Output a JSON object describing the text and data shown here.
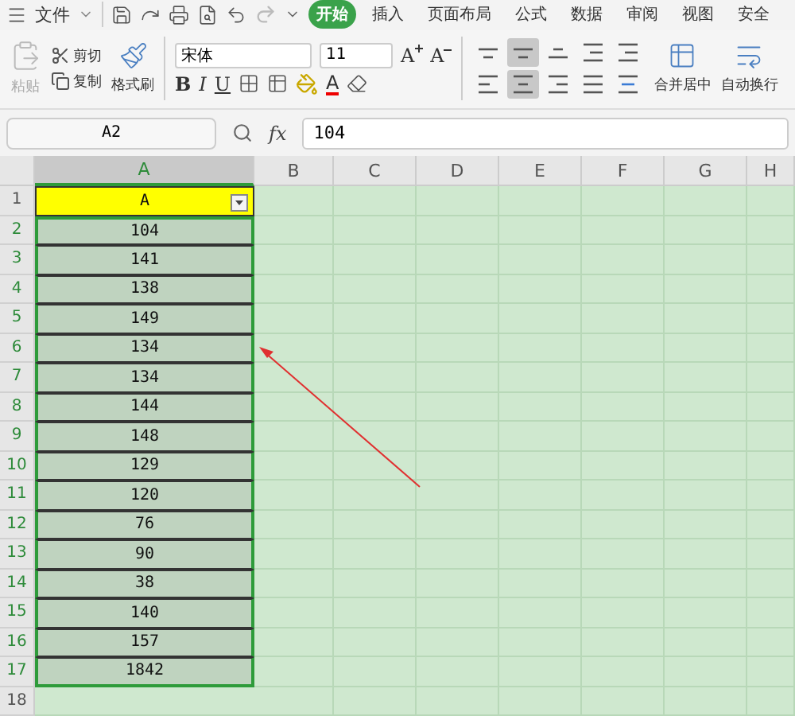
{
  "menu": {
    "file": "文件",
    "tabs": [
      {
        "label": "开始",
        "selected": true
      },
      {
        "label": "插入",
        "selected": false
      },
      {
        "label": "页面布局",
        "selected": false
      },
      {
        "label": "公式",
        "selected": false
      },
      {
        "label": "数据",
        "selected": false
      },
      {
        "label": "审阅",
        "selected": false
      },
      {
        "label": "视图",
        "selected": false
      },
      {
        "label": "安全",
        "selected": false
      }
    ]
  },
  "ribbon": {
    "paste": {
      "label": "粘贴",
      "disabled": true
    },
    "cut": "剪切",
    "copy": "复制",
    "format_painter": "格式刷",
    "font": "宋体",
    "size": "11",
    "bold": "B",
    "italic": "I",
    "underline": "U",
    "grow_font": "A",
    "shrink_font": "A",
    "font_color": "A",
    "align": [
      {
        "kind": "top",
        "selected": false
      },
      {
        "kind": "middle",
        "selected": true
      },
      {
        "kind": "bottom",
        "selected": false
      },
      {
        "kind": "outdent",
        "selected": false
      },
      {
        "kind": "indent",
        "selected": false
      },
      {
        "kind": "left",
        "selected": false
      },
      {
        "kind": "center",
        "selected": true
      },
      {
        "kind": "right",
        "selected": false
      },
      {
        "kind": "justify",
        "selected": false
      },
      {
        "kind": "distribute",
        "selected": false
      }
    ],
    "merge": "合并居中",
    "wrap": "自动换行"
  },
  "formula_bar": {
    "name_box": "A2",
    "fx": "fx",
    "value": "104"
  },
  "columns": [
    {
      "label": "A",
      "selected": true
    },
    {
      "label": "B",
      "selected": false
    },
    {
      "label": "C",
      "selected": false
    },
    {
      "label": "D",
      "selected": false
    },
    {
      "label": "E",
      "selected": false
    },
    {
      "label": "F",
      "selected": false
    },
    {
      "label": "G",
      "selected": false
    },
    {
      "label": "H",
      "selected": false
    }
  ],
  "rows": [
    {
      "number": "1",
      "value": "A",
      "kind": "header",
      "selected": false
    },
    {
      "number": "2",
      "value": "104",
      "kind": "data",
      "selected": true
    },
    {
      "number": "3",
      "value": "141",
      "kind": "data",
      "selected": true
    },
    {
      "number": "4",
      "value": "138",
      "kind": "data",
      "selected": true
    },
    {
      "number": "5",
      "value": "149",
      "kind": "data",
      "selected": true
    },
    {
      "number": "6",
      "value": "134",
      "kind": "data",
      "selected": true
    },
    {
      "number": "7",
      "value": "134",
      "kind": "data",
      "selected": true
    },
    {
      "number": "8",
      "value": "144",
      "kind": "data",
      "selected": true
    },
    {
      "number": "9",
      "value": "148",
      "kind": "data",
      "selected": true
    },
    {
      "number": "10",
      "value": "129",
      "kind": "data",
      "selected": true
    },
    {
      "number": "11",
      "value": "120",
      "kind": "data",
      "selected": true
    },
    {
      "number": "12",
      "value": "76",
      "kind": "data",
      "selected": true
    },
    {
      "number": "13",
      "value": "90",
      "kind": "data",
      "selected": true
    },
    {
      "number": "14",
      "value": "38",
      "kind": "data",
      "selected": true
    },
    {
      "number": "15",
      "value": "140",
      "kind": "data",
      "selected": true
    },
    {
      "number": "16",
      "value": "157",
      "kind": "data",
      "selected": true
    },
    {
      "number": "17",
      "value": "1842",
      "kind": "data",
      "selected": true
    },
    {
      "number": "18",
      "kind": "empty",
      "selected": false
    }
  ]
}
